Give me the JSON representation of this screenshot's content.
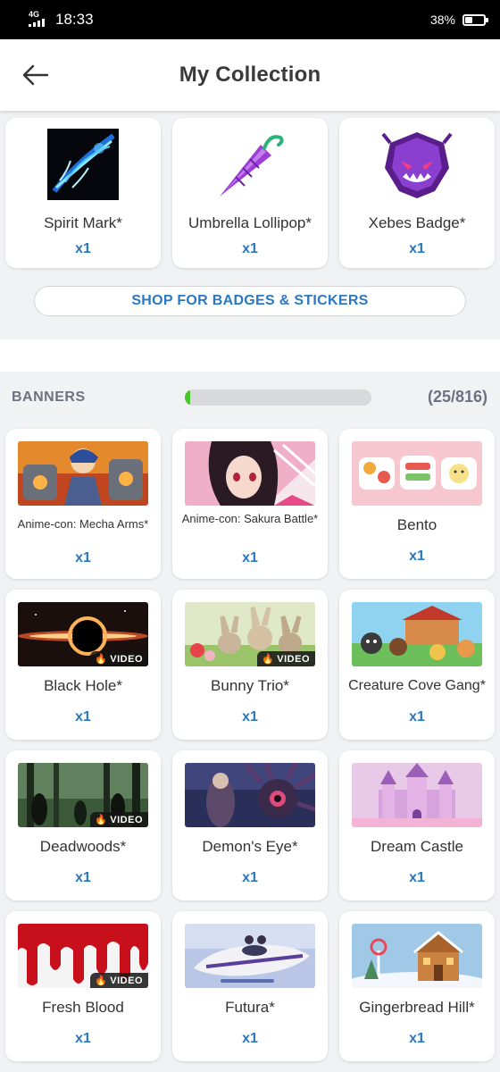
{
  "status_bar": {
    "network": "4G",
    "time": "18:33",
    "battery": "38%",
    "battery_level": 0.38
  },
  "header": {
    "title": "My Collection"
  },
  "badges": [
    {
      "name": "Spirit Mark*",
      "count": "x1",
      "icon": "spirit-mark-image"
    },
    {
      "name": "Umbrella Lollipop*",
      "count": "x1",
      "icon": "umbrella-lollipop-image"
    },
    {
      "name": "Xebes Badge*",
      "count": "x1",
      "icon": "xebes-badge-image"
    }
  ],
  "shop_button": {
    "label": "SHOP FOR BADGES & STICKERS"
  },
  "banners_section": {
    "title": "BANNERS",
    "count": "(25/816)",
    "progress": 0.0306
  },
  "video_label": "VIDEO",
  "banners": [
    {
      "name": "Anime-con: Mecha Arms*",
      "count": "x1",
      "video": false
    },
    {
      "name": "Anime-con: Sakura Battle*",
      "count": "x1",
      "video": false
    },
    {
      "name": "Bento",
      "count": "x1",
      "video": false
    },
    {
      "name": "Black Hole*",
      "count": "x1",
      "video": true
    },
    {
      "name": "Bunny Trio*",
      "count": "x1",
      "video": true
    },
    {
      "name": "Creature Cove Gang*",
      "count": "x1",
      "video": false
    },
    {
      "name": "Deadwoods*",
      "count": "x1",
      "video": true
    },
    {
      "name": "Demon's Eye*",
      "count": "x1",
      "video": false
    },
    {
      "name": "Dream Castle",
      "count": "x1",
      "video": false
    },
    {
      "name": "Fresh Blood",
      "count": "x1",
      "video": true
    },
    {
      "name": "Futura*",
      "count": "x1",
      "video": false
    },
    {
      "name": "Gingerbread Hill*",
      "count": "x1",
      "video": false
    }
  ],
  "colors": {
    "accent": "#2b78c2",
    "progress": "#4ac52e",
    "muted": "#6b7280"
  }
}
